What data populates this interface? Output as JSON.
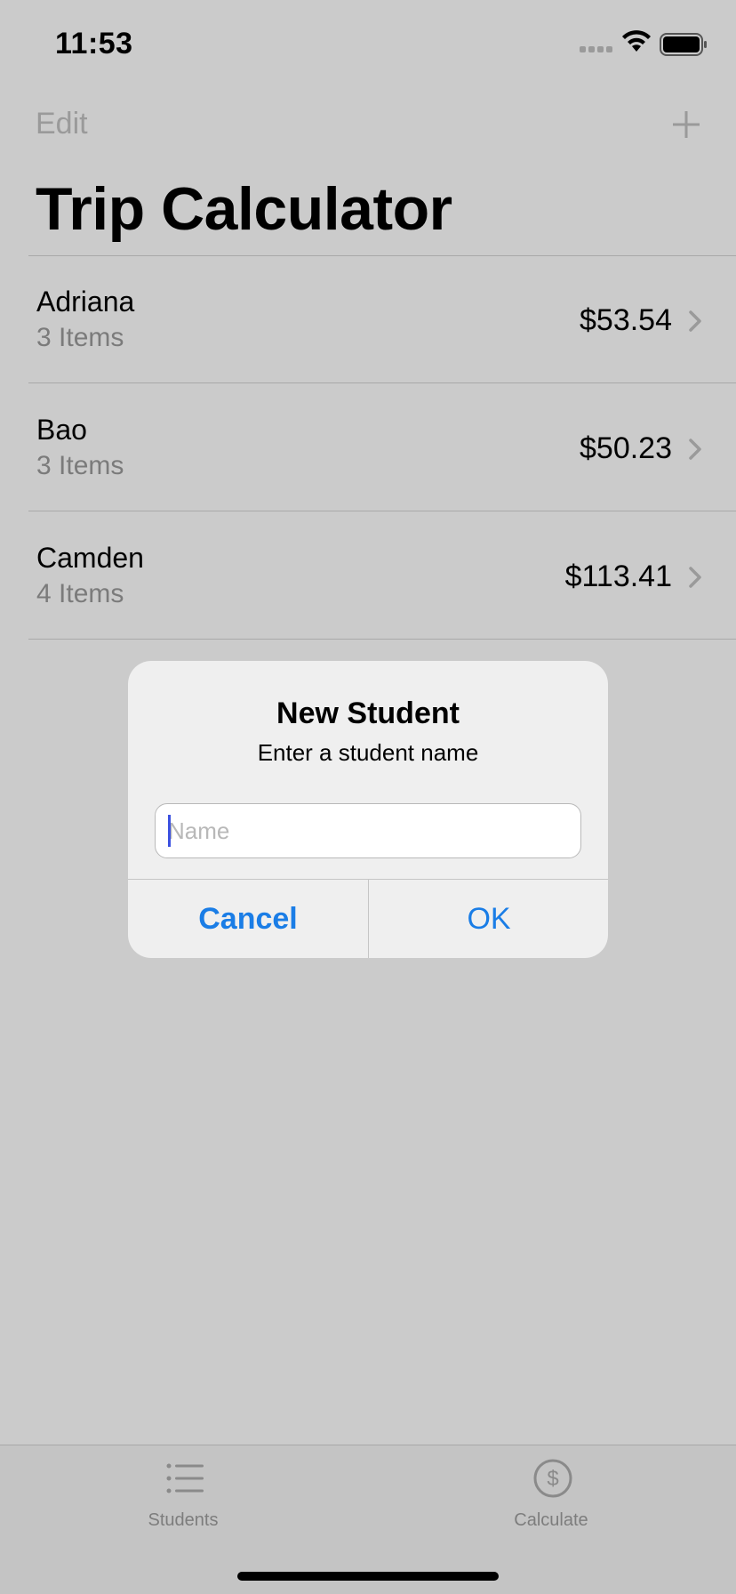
{
  "status_bar": {
    "time": "11:53"
  },
  "nav": {
    "edit_label": "Edit",
    "add_icon": "plus-icon"
  },
  "title": "Trip Calculator",
  "students": [
    {
      "name": "Adriana",
      "items": "3 Items",
      "total": "$53.54"
    },
    {
      "name": "Bao",
      "items": "3 Items",
      "total": "$50.23"
    },
    {
      "name": "Camden",
      "items": "4 Items",
      "total": "$113.41"
    }
  ],
  "alert": {
    "title": "New Student",
    "message": "Enter a student name",
    "input_placeholder": "Name",
    "input_value": "",
    "cancel_label": "Cancel",
    "ok_label": "OK"
  },
  "tabs": [
    {
      "label": "Students",
      "icon": "list-icon"
    },
    {
      "label": "Calculate",
      "icon": "dollar-circle-icon"
    }
  ],
  "colors": {
    "accent": "#1a7de6",
    "background": "#cbcbcb",
    "alert_background": "#efefef"
  }
}
